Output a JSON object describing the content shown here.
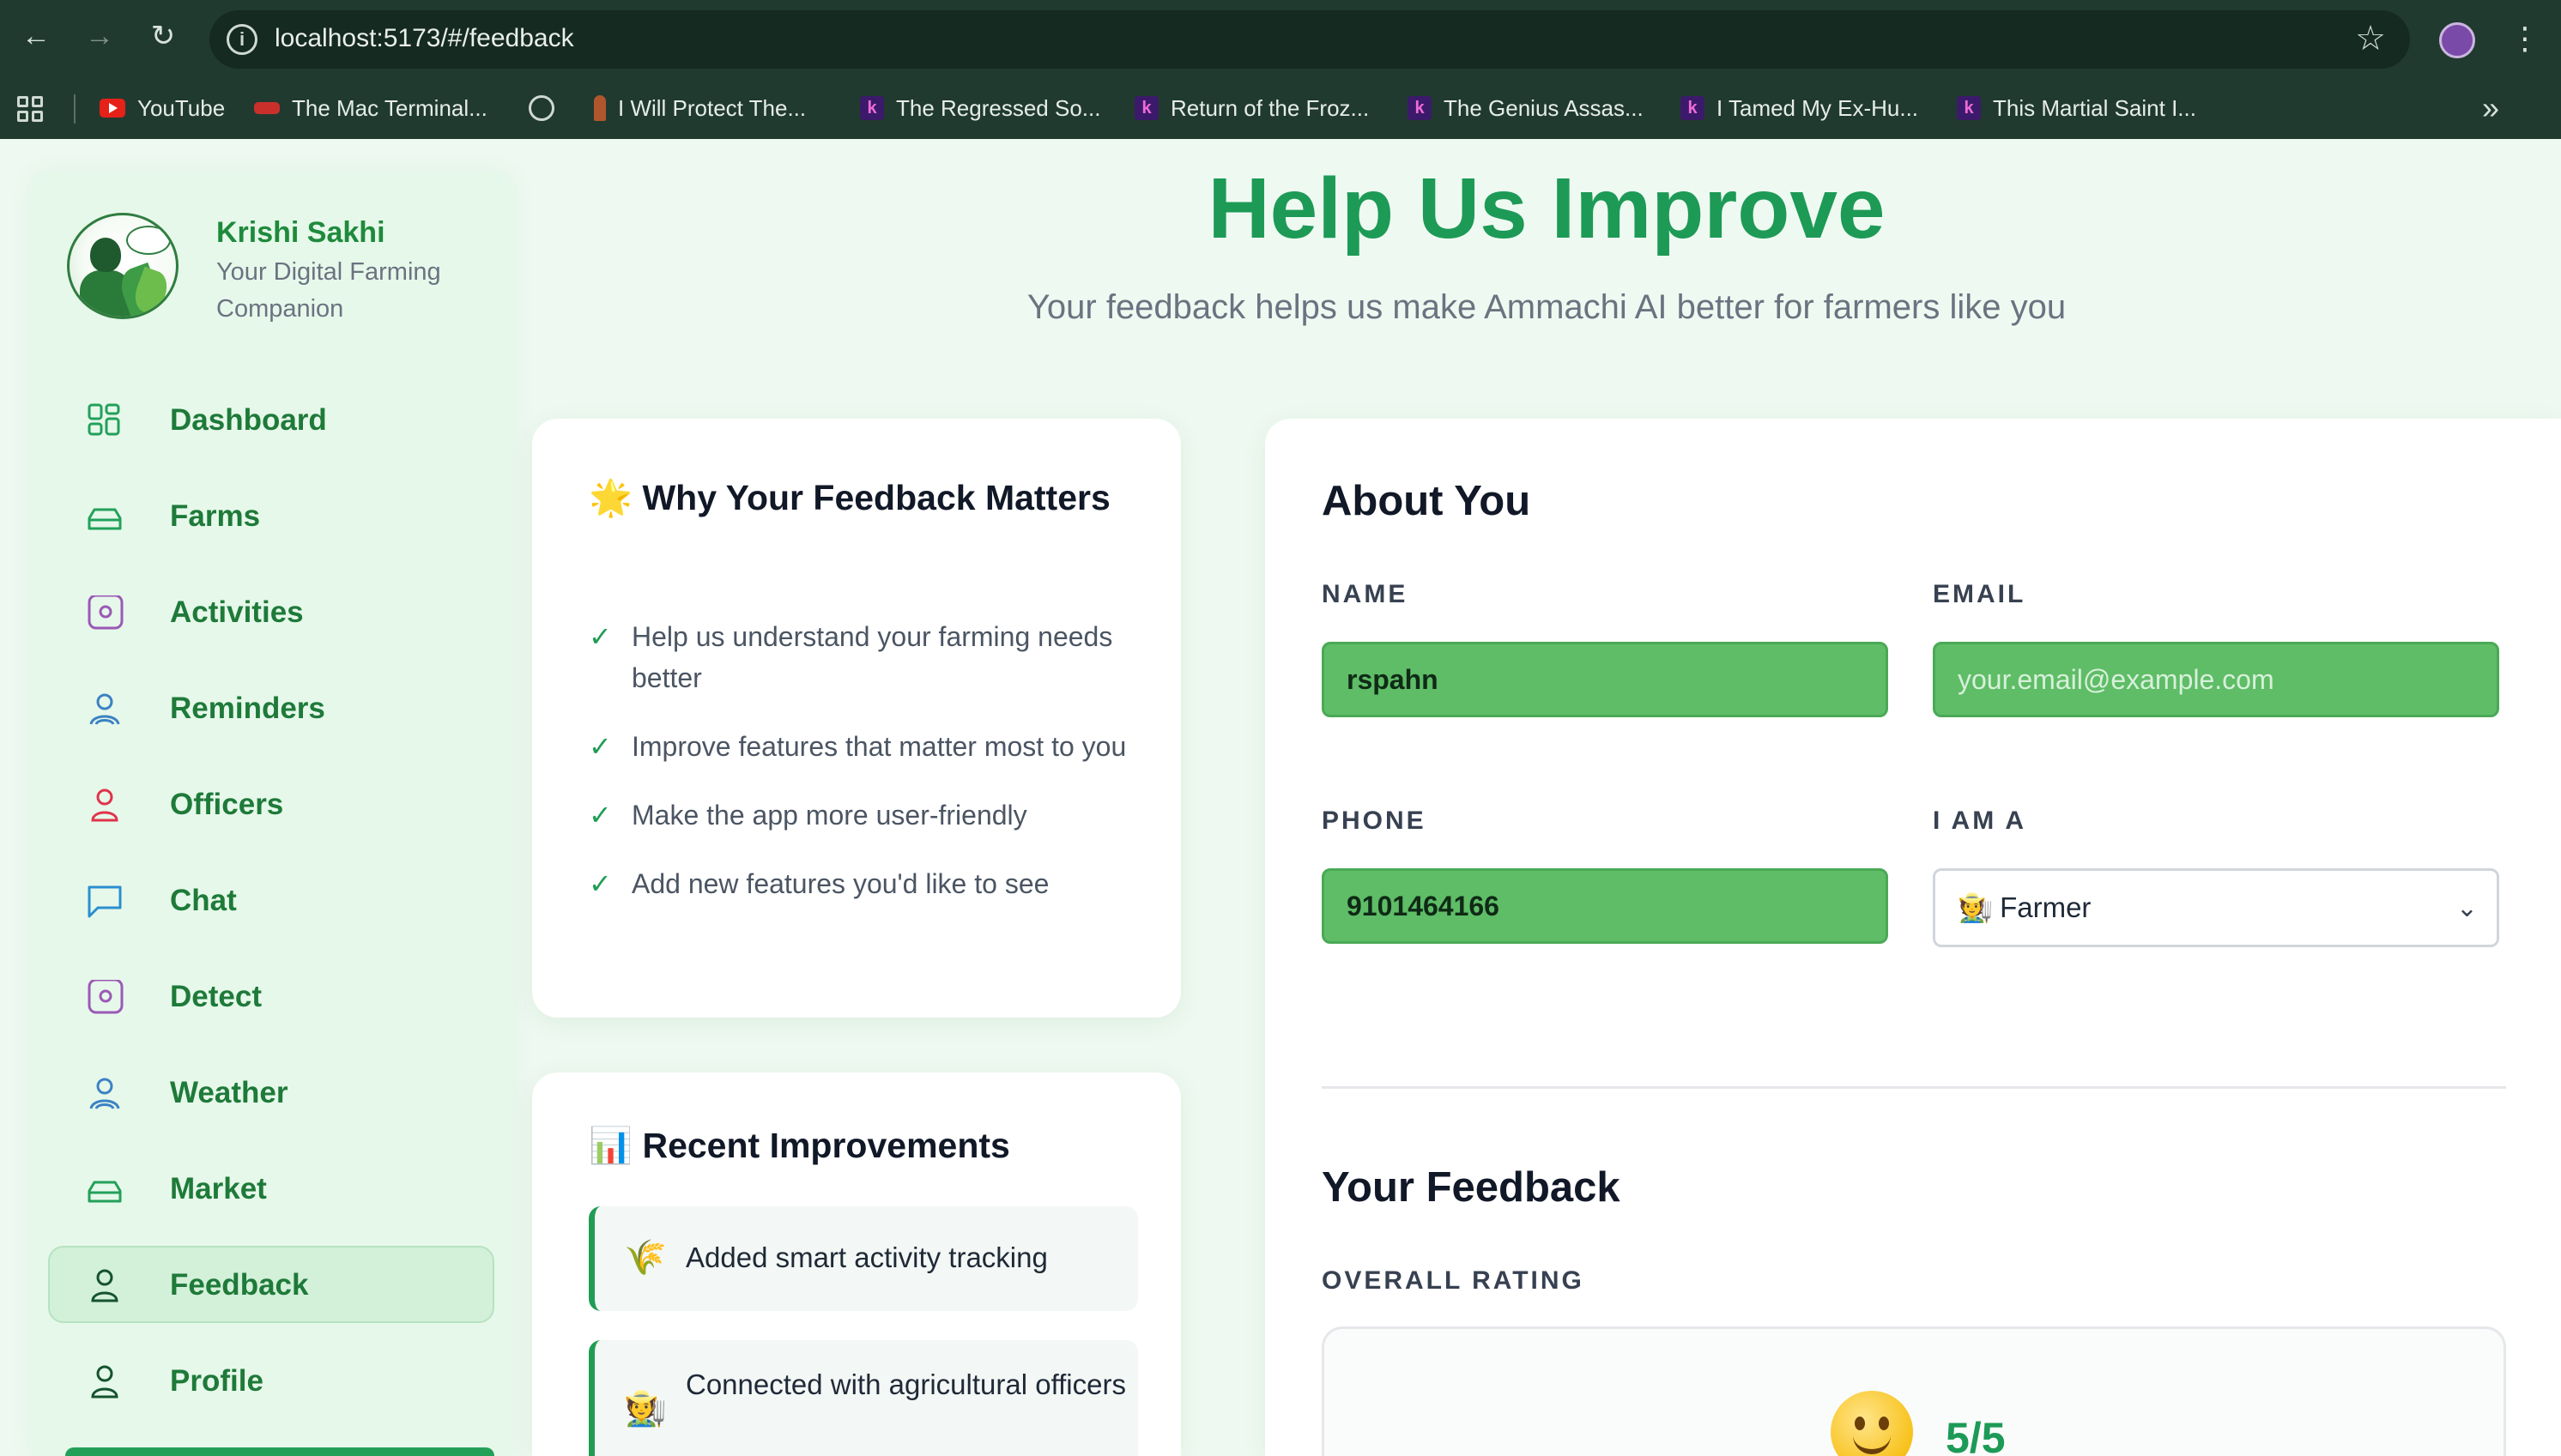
{
  "browser": {
    "url": "localhost:5173/#/feedback",
    "bookmarks": [
      {
        "label": "YouTube",
        "icon": "youtube-icon"
      },
      {
        "label": "The Mac Terminal...",
        "icon": "red-badge-icon"
      },
      {
        "label": "",
        "icon": "globe-icon"
      },
      {
        "label": "I Will Protect The...",
        "icon": "figure-icon"
      },
      {
        "label": "The Regressed So...",
        "icon": "k-logo-icon"
      },
      {
        "label": "Return of the Froz...",
        "icon": "k-logo-icon"
      },
      {
        "label": "The Genius Assas...",
        "icon": "k-logo-icon"
      },
      {
        "label": "I Tamed My Ex-Hu...",
        "icon": "k-logo-icon"
      },
      {
        "label": "This Martial Saint I...",
        "icon": "k-logo-icon"
      }
    ]
  },
  "sidebar": {
    "brand_name": "Krishi Sakhi",
    "brand_tagline": "Your Digital Farming Companion",
    "items": [
      {
        "label": "Dashboard",
        "icon": "grid-icon"
      },
      {
        "label": "Farms",
        "icon": "tray-icon"
      },
      {
        "label": "Activities",
        "icon": "target-icon"
      },
      {
        "label": "Reminders",
        "icon": "user-icon"
      },
      {
        "label": "Officers",
        "icon": "person-icon"
      },
      {
        "label": "Chat",
        "icon": "chat-icon"
      },
      {
        "label": "Detect",
        "icon": "target-icon"
      },
      {
        "label": "Weather",
        "icon": "user-icon"
      },
      {
        "label": "Market",
        "icon": "tray-icon"
      },
      {
        "label": "Feedback",
        "icon": "person-icon",
        "active": true
      },
      {
        "label": "Profile",
        "icon": "person-icon"
      }
    ]
  },
  "header": {
    "title": "Help Us Improve",
    "subtitle": "Your feedback helps us make Ammachi AI better for farmers like you"
  },
  "why_card": {
    "title_emoji": "🌟",
    "title": "Why Your Feedback Matters",
    "items": [
      "Help us understand your farming needs better",
      "Improve features that matter most to you",
      "Make the app more user-friendly",
      "Add new features you'd like to see"
    ]
  },
  "recent_card": {
    "title_emoji": "📊",
    "title": "Recent Improvements",
    "items": [
      {
        "emoji": "🌾",
        "text": "Added smart activity tracking"
      },
      {
        "emoji": "🧑‍🌾",
        "text": "Connected with agricultural officers"
      }
    ]
  },
  "form": {
    "about_title": "About You",
    "name_label": "NAME",
    "name_value": "rspahn",
    "email_label": "EMAIL",
    "email_value": "",
    "email_placeholder": "your.email@example.com",
    "phone_label": "PHONE",
    "phone_value": "9101464166",
    "role_label": "I AM A",
    "role_emoji": "🧑‍🌾",
    "role_value": "Farmer",
    "feedback_title": "Your Feedback",
    "rating_label": "OVERALL RATING",
    "rating_value": "5/5"
  },
  "colors": {
    "brand_green": "#1d9a56",
    "nav_text": "#1e7a39",
    "input_fill": "#5ebd66",
    "page_bg": "#eefaf1"
  }
}
